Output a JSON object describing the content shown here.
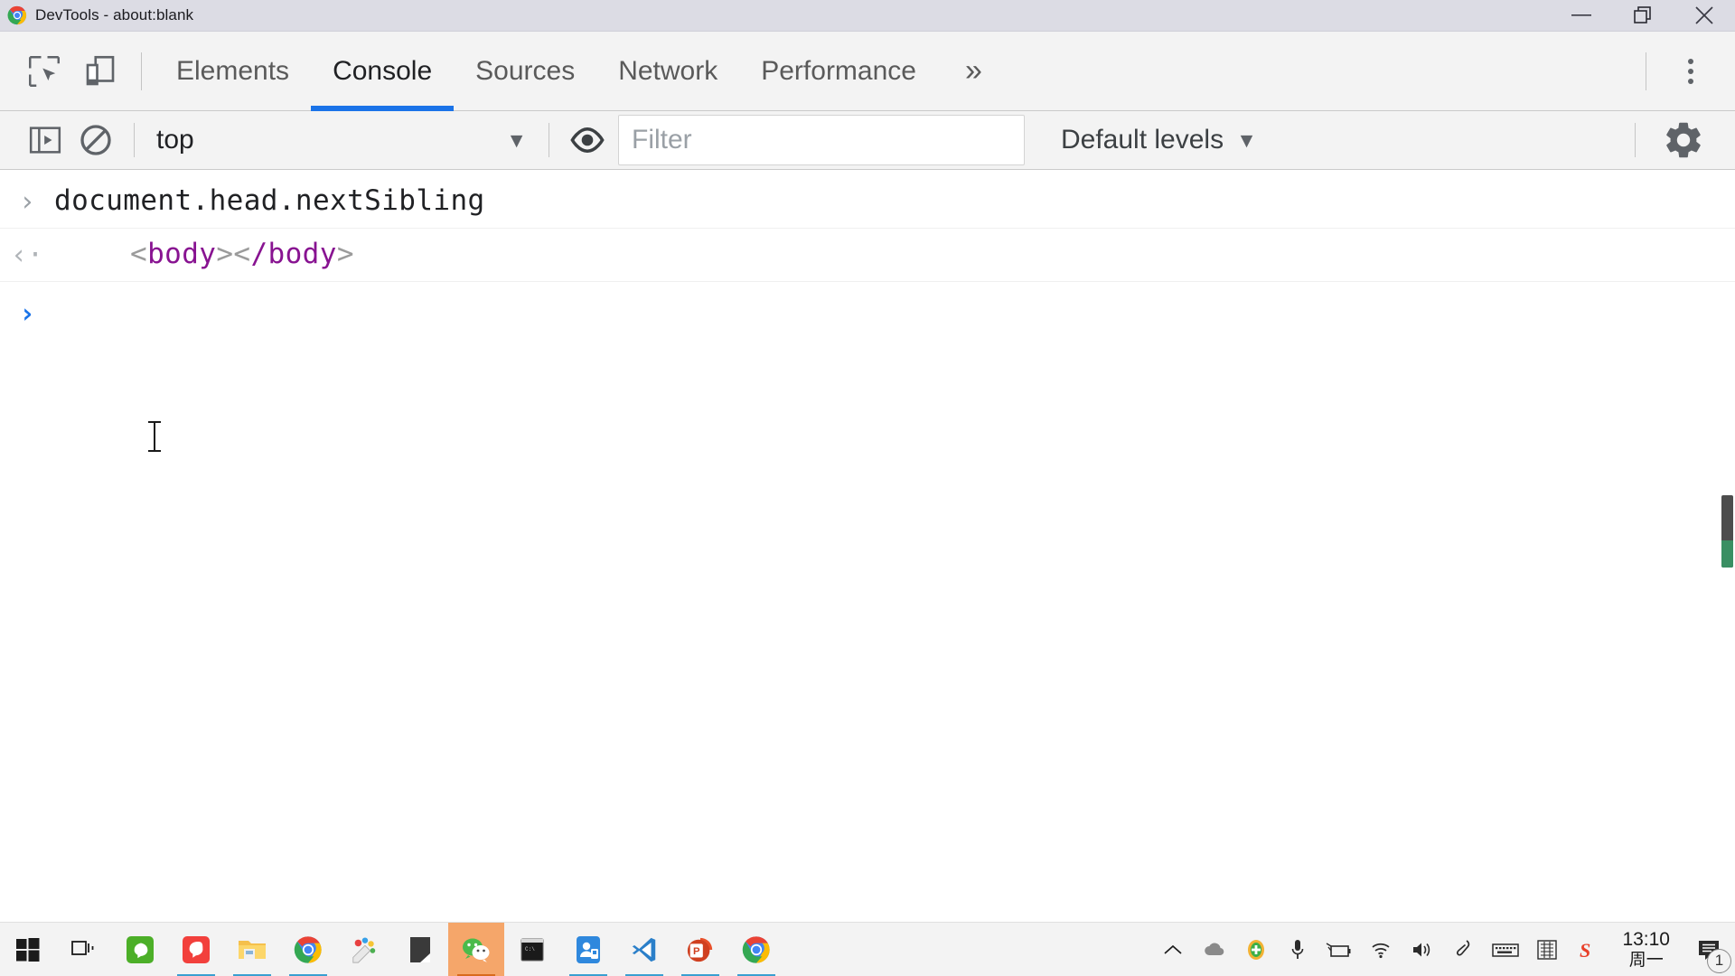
{
  "window": {
    "title": "DevTools - about:blank",
    "logo_icon": "chrome-logo-icon",
    "minimize_icon": "minimize-icon",
    "restore_icon": "restore-icon",
    "close_icon": "close-icon"
  },
  "devtools": {
    "inspect_icon": "inspect-element-icon",
    "device_icon": "device-toolbar-icon",
    "more_tabs_label": "»",
    "menu_icon": "more-options-icon",
    "accent_color": "#1a73e8",
    "tabs": [
      {
        "label": "Elements",
        "active": false
      },
      {
        "label": "Console",
        "active": true
      },
      {
        "label": "Sources",
        "active": false
      },
      {
        "label": "Network",
        "active": false
      },
      {
        "label": "Performance",
        "active": false
      }
    ]
  },
  "console_toolbar": {
    "sidebar_icon": "console-sidebar-icon",
    "clear_icon": "clear-console-icon",
    "context": {
      "value": "top",
      "caret": "▼"
    },
    "eye_icon": "live-expression-eye-icon",
    "filter": {
      "placeholder": "Filter",
      "value": ""
    },
    "levels": {
      "label": "Default levels",
      "caret": "▼"
    },
    "settings_icon": "settings-gear-icon"
  },
  "console": {
    "messages": [
      {
        "kind": "input",
        "gutter": "›",
        "text": "document.head.nextSibling"
      },
      {
        "kind": "output",
        "gutter": "‹·",
        "parts": [
          {
            "t": "<",
            "cls": "tagbr"
          },
          {
            "t": "body",
            "cls": "tagname"
          },
          {
            "t": "><",
            "cls": "tagbr"
          },
          {
            "t": "/body",
            "cls": "tagname"
          },
          {
            "t": ">",
            "cls": "tagbr"
          }
        ],
        "text": "<body></body>"
      }
    ],
    "prompt_caret": "›"
  },
  "taskbar": {
    "items": [
      {
        "name": "start-button",
        "icon": "windows-start-icon",
        "running": false,
        "active": false
      },
      {
        "name": "task-view-button",
        "icon": "task-view-icon",
        "running": false,
        "active": false
      },
      {
        "name": "taskbar-app-phone-green",
        "icon": "phone-green-icon",
        "running": false,
        "active": false
      },
      {
        "name": "taskbar-app-phone-red",
        "icon": "phone-red-icon",
        "running": true,
        "active": false
      },
      {
        "name": "taskbar-file-explorer",
        "icon": "file-explorer-icon",
        "running": true,
        "active": false
      },
      {
        "name": "taskbar-chrome",
        "icon": "chrome-icon",
        "running": true,
        "active": false
      },
      {
        "name": "taskbar-paint3d",
        "icon": "paint-3d-icon",
        "running": false,
        "active": false
      },
      {
        "name": "taskbar-notes",
        "icon": "notes-icon",
        "running": false,
        "active": false
      },
      {
        "name": "taskbar-wechat",
        "icon": "wechat-icon",
        "running": true,
        "active": true
      },
      {
        "name": "taskbar-terminal",
        "icon": "terminal-icon",
        "running": false,
        "active": false
      },
      {
        "name": "taskbar-app-blue",
        "icon": "blue-app-icon",
        "running": true,
        "active": false
      },
      {
        "name": "taskbar-vscode",
        "icon": "vscode-icon",
        "running": true,
        "active": false
      },
      {
        "name": "taskbar-powerpoint",
        "icon": "powerpoint-icon",
        "running": true,
        "active": false
      },
      {
        "name": "taskbar-chrome-devtools",
        "icon": "chrome-icon",
        "running": true,
        "active": false
      }
    ],
    "tray": [
      {
        "name": "tray-show-hidden",
        "icon": "chevron-up-icon"
      },
      {
        "name": "tray-cloud",
        "icon": "cloud-icon"
      },
      {
        "name": "tray-security",
        "icon": "security-shield-icon"
      },
      {
        "name": "tray-microphone",
        "icon": "microphone-icon"
      },
      {
        "name": "tray-battery",
        "icon": "battery-icon"
      },
      {
        "name": "tray-network",
        "icon": "wifi-icon"
      },
      {
        "name": "tray-volume",
        "icon": "volume-icon"
      },
      {
        "name": "tray-pen",
        "icon": "pen-icon"
      },
      {
        "name": "tray-keyboard",
        "icon": "keyboard-icon"
      },
      {
        "name": "tray-ime",
        "icon": "ime-icon"
      },
      {
        "name": "tray-sogou",
        "icon": "sogou-icon"
      }
    ],
    "clock": {
      "time": "13:10",
      "date": "周一"
    },
    "notifications": {
      "icon": "action-center-icon",
      "count": "1"
    }
  }
}
